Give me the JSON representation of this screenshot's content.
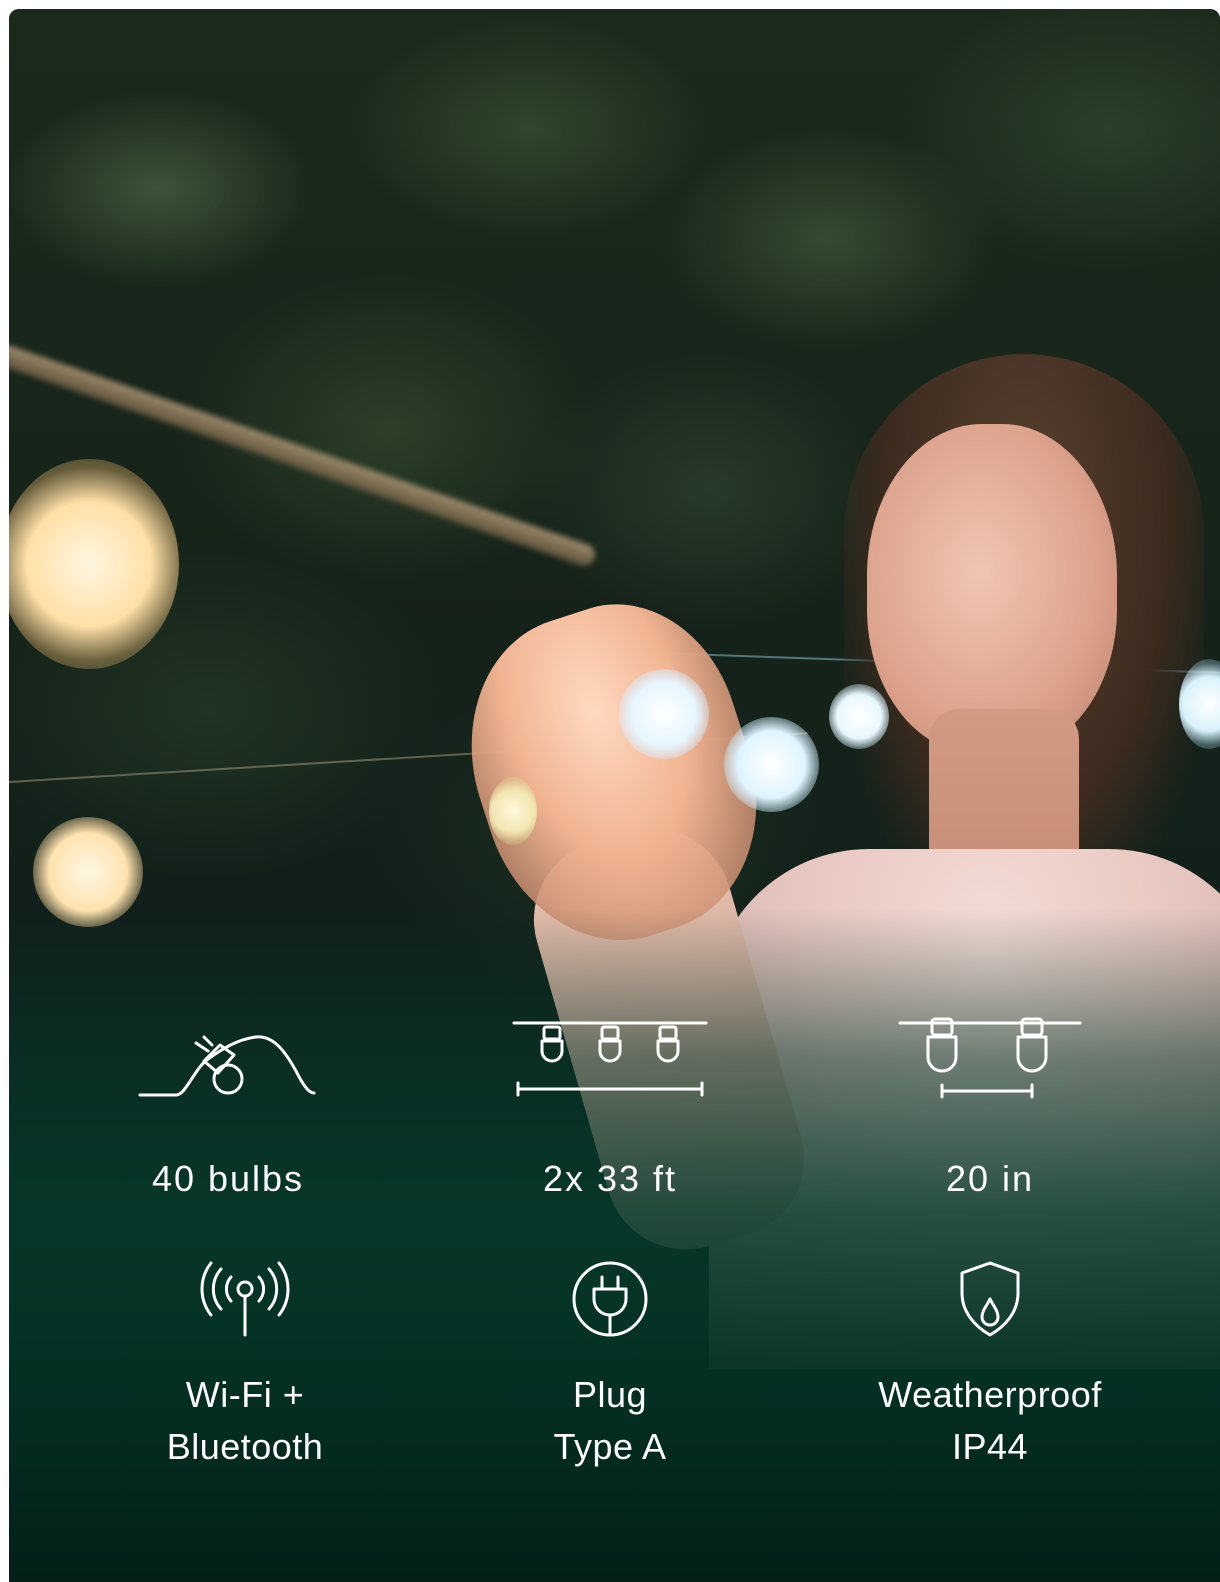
{
  "features": [
    {
      "icon": "string-light-bulb-icon",
      "label": "40 bulbs"
    },
    {
      "icon": "three-bulbs-length-icon",
      "label": "2x 33 ft"
    },
    {
      "icon": "two-bulbs-spacing-icon",
      "label": "20 in"
    },
    {
      "icon": "wireless-signal-icon",
      "lines": [
        "Wi-Fi +",
        "Bluetooth"
      ]
    },
    {
      "icon": "plug-icon",
      "lines": [
        "Plug",
        "Type A"
      ]
    },
    {
      "icon": "water-shield-icon",
      "lines": [
        "Weatherproof",
        "IP44"
      ]
    }
  ],
  "colors": {
    "overlay_green": "#05402f",
    "text": "#ffffff"
  }
}
